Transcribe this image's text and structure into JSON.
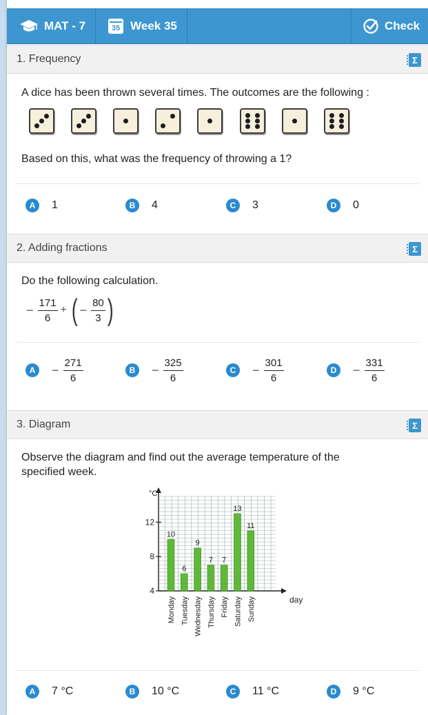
{
  "header": {
    "subject": "MAT - 7",
    "week_number": "35",
    "week_label": "Week 35",
    "check_label": "Check"
  },
  "colors": {
    "header_bg": "#3d96cf",
    "badge": "#2a8ad0",
    "bar": "#5fb83a"
  },
  "q1": {
    "title": "1. Frequency",
    "prompt": "A dice has been thrown several times. The outcomes are the following :",
    "dice": [
      3,
      3,
      1,
      2,
      1,
      6,
      1,
      6
    ],
    "question": "Based on this, what was the frequency of throwing a 1?",
    "answers": [
      {
        "letter": "A",
        "value": "1"
      },
      {
        "letter": "B",
        "value": "4"
      },
      {
        "letter": "C",
        "value": "3"
      },
      {
        "letter": "D",
        "value": "0"
      }
    ]
  },
  "q2": {
    "title": "2. Adding fractions",
    "prompt": "Do the following calculation.",
    "expr": {
      "sign1": "−",
      "num1": "171",
      "den1": "6",
      "plus": "+",
      "sign2": "−",
      "num2": "80",
      "den2": "3"
    },
    "answers": [
      {
        "letter": "A",
        "sign": "−",
        "num": "271",
        "den": "6"
      },
      {
        "letter": "B",
        "sign": "−",
        "num": "325",
        "den": "6"
      },
      {
        "letter": "C",
        "sign": "−",
        "num": "301",
        "den": "6"
      },
      {
        "letter": "D",
        "sign": "−",
        "num": "331",
        "den": "6"
      }
    ]
  },
  "q3": {
    "title": "3. Diagram",
    "prompt_line1": "Observe the diagram and find out the average temperature of the",
    "prompt_line2": "specified week.",
    "answers": [
      {
        "letter": "A",
        "value": "7 °C"
      },
      {
        "letter": "B",
        "value": "10 °C"
      },
      {
        "letter": "C",
        "value": "11 °C"
      },
      {
        "letter": "D",
        "value": "9 °C"
      }
    ]
  },
  "chart_data": {
    "type": "bar",
    "categories": [
      "Monday",
      "Tuesday",
      "Wednesday",
      "Thursday",
      "Friday",
      "Saturday",
      "Sunday"
    ],
    "values": [
      10,
      6,
      9,
      7,
      7,
      13,
      11
    ],
    "ylabel": "°C",
    "xlabel": "days",
    "yticks": [
      "4",
      "8",
      "12"
    ],
    "ylim": [
      4,
      15
    ],
    "grid": true
  }
}
